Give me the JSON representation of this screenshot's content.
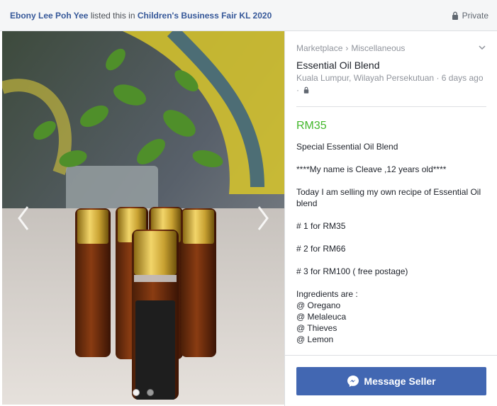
{
  "header": {
    "poster": "Ebony Lee Poh Yee",
    "action": "listed this in",
    "group": "Children's Business Fair KL 2020",
    "privacy": "Private"
  },
  "photo": {
    "dots": 2,
    "active_dot": 0
  },
  "listing": {
    "breadcrumb": [
      "Marketplace",
      "›",
      "Miscellaneous"
    ],
    "title": "Essential Oil Blend",
    "location": "Kuala Lumpur, Wilayah Persekutuan",
    "time": "6 days ago",
    "separator": "·",
    "price": "RM35",
    "description": {
      "line1": "Special Essential Oil Blend",
      "line2": "****My name is Cleave ,12 years old****",
      "line3": "Today I am selling my own recipe of Essential Oil blend",
      "line4": "# 1 for RM35",
      "line5": "# 2 for RM66",
      "line6": "# 3 for RM100 ( free postage)",
      "ingredients_label": "Ingredients are :",
      "ingredients": [
        "@ Oregano",
        "@ Melaleuca",
        "@ Thieves",
        "@ Lemon"
      ]
    },
    "message_button": "Message Seller"
  },
  "colors": {
    "link": "#365899",
    "price": "#42b72a",
    "button": "#4267b2"
  }
}
